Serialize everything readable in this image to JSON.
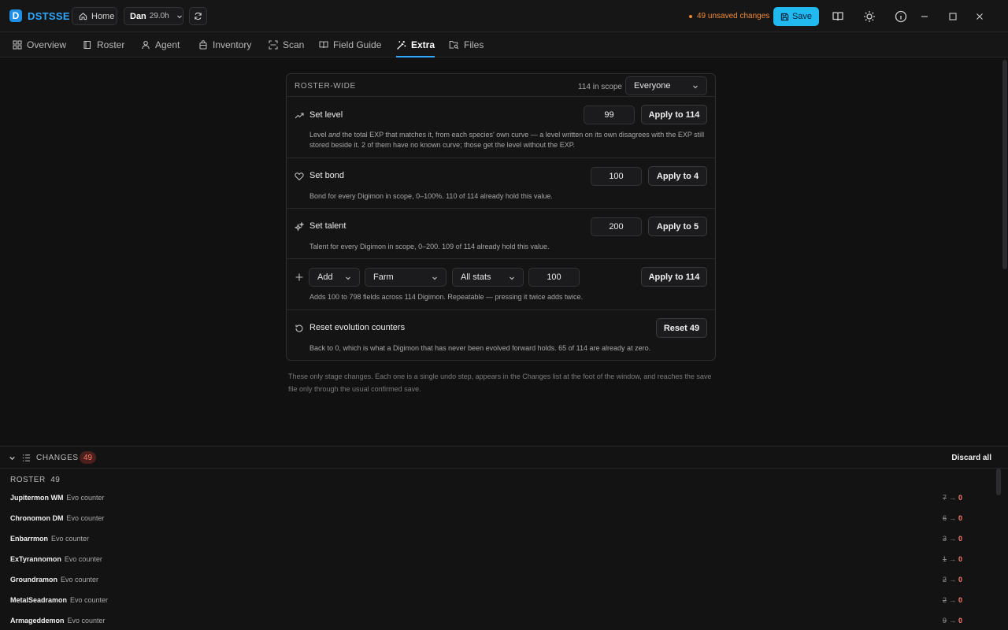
{
  "app": {
    "logo_letter": "D",
    "name": "DSTSSE"
  },
  "titlebar": {
    "home_label": "Home",
    "profile_name": "Dan",
    "profile_hours": "29.0h",
    "unsaved_text": "49 unsaved changes",
    "save_label": "Save"
  },
  "tabs": [
    {
      "label": "Overview",
      "icon": "grid-icon"
    },
    {
      "label": "Roster",
      "icon": "book-icon"
    },
    {
      "label": "Agent",
      "icon": "person-icon"
    },
    {
      "label": "Inventory",
      "icon": "bag-icon"
    },
    {
      "label": "Scan",
      "icon": "scan-icon"
    },
    {
      "label": "Field Guide",
      "icon": "open-book-icon"
    },
    {
      "label": "Extra",
      "icon": "magic-wand-icon",
      "active": true
    },
    {
      "label": "Files",
      "icon": "folder-search-icon"
    }
  ],
  "card": {
    "title": "ROSTER-WIDE",
    "scope_count": "114 in scope",
    "scope_value": "Everyone",
    "rows": {
      "level": {
        "title": "Set level",
        "value": "99",
        "button": "Apply to 114",
        "desc_pre": "Level ",
        "desc_em": "and",
        "desc_post": " the total EXP that matches it, from each species' own curve — a level written on its own disagrees with the EXP still stored beside it. 2 of them have no known curve; those get the level without the EXP."
      },
      "bond": {
        "title": "Set bond",
        "value": "100",
        "button": "Apply to 4",
        "desc": "Bond for every Digimon in scope, 0–100%. 110 of 114 already hold this value."
      },
      "talent": {
        "title": "Set talent",
        "value": "200",
        "button": "Apply to 5",
        "desc": "Talent for every Digimon in scope, 0–200. 109 of 114 already hold this value."
      },
      "add": {
        "op": "Add",
        "source": "Farm",
        "stat": "All stats",
        "value": "100",
        "button": "Apply to 114",
        "desc": "Adds 100 to 798 fields across 114 Digimon. Repeatable — pressing it twice adds twice."
      },
      "reset": {
        "title": "Reset evolution counters",
        "button": "Reset 49",
        "desc": "Back to 0, which is what a Digimon that has never been evolved forward holds. 65 of 114 are already at zero."
      }
    },
    "footnote": "These only stage changes. Each one is a single undo step, appears in the Changes list at the foot of the window, and reaches the save file only through the usual confirmed save."
  },
  "changes": {
    "title": "CHANGES",
    "count": "49",
    "discard_label": "Discard all",
    "group_label": "ROSTER",
    "group_count": "49",
    "items": [
      {
        "name": "Jupitermon WM",
        "field": "Evo counter",
        "old": "7",
        "new": "0"
      },
      {
        "name": "Chronomon DM",
        "field": "Evo counter",
        "old": "6",
        "new": "0"
      },
      {
        "name": "Enbarrmon",
        "field": "Evo counter",
        "old": "3",
        "new": "0"
      },
      {
        "name": "ExTyrannomon",
        "field": "Evo counter",
        "old": "1",
        "new": "0"
      },
      {
        "name": "Groundramon",
        "field": "Evo counter",
        "old": "2",
        "new": "0"
      },
      {
        "name": "MetalSeadramon",
        "field": "Evo counter",
        "old": "2",
        "new": "0"
      },
      {
        "name": "Armageddemon",
        "field": "Evo counter",
        "old": "9",
        "new": "0"
      }
    ]
  },
  "colors": {
    "accent": "#2fa7ff",
    "save": "#22b8f0",
    "warning": "#f08a3a",
    "badge_text": "#ff7a6a"
  }
}
